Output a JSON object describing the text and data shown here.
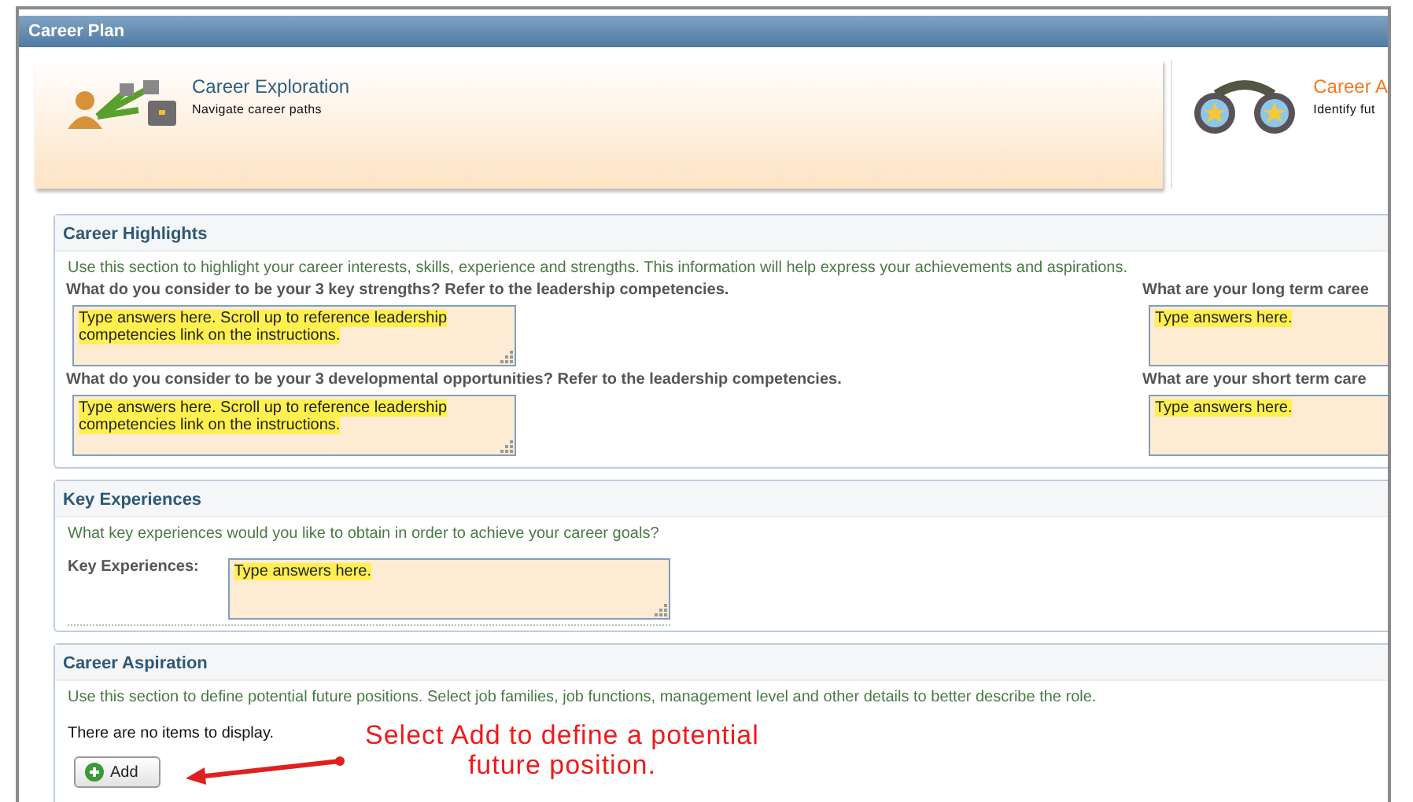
{
  "header": {
    "title": "Career Plan"
  },
  "cards": [
    {
      "kind": "exploration",
      "title": "Career Exploration",
      "subtitle": "Navigate career paths",
      "selected": true
    },
    {
      "kind": "aspiration",
      "title": "Career A",
      "subtitle": "Identify fut",
      "selected": false
    }
  ],
  "career_highlights": {
    "title": "Career Highlights",
    "description": "Use this section to highlight your career interests, skills, experience and strengths. This information will help express your achievements and aspirations.",
    "left_questions": [
      {
        "label": "What do you consider to be your 3 key strengths? Refer to the leadership competencies.",
        "value": "Type answers here. Scroll up to reference leadership competencies link on the instructions."
      },
      {
        "label": "What do you consider to be your 3 developmental opportunities? Refer to the leadership competencies.",
        "value": "Type answers here. Scroll up to reference leadership competencies link on the instructions."
      }
    ],
    "right_questions": [
      {
        "label": "What are your long term caree",
        "value": "Type answers here."
      },
      {
        "label": "What are your short term care",
        "value": "Type answers here."
      }
    ]
  },
  "key_experiences": {
    "title": "Key Experiences",
    "description": "What key experiences would you like to obtain in order to achieve your career goals?",
    "field": {
      "label": "Key Experiences:",
      "value": "Type answers here."
    }
  },
  "career_aspiration": {
    "title": "Career Aspiration",
    "description": "Use this section to define potential future positions. Select job families, job functions, management level and other details to better describe the role.",
    "empty_message": "There are no items to display.",
    "add_button": "Add",
    "annotation": [
      "Select Add to define a potential",
      "future position."
    ]
  }
}
